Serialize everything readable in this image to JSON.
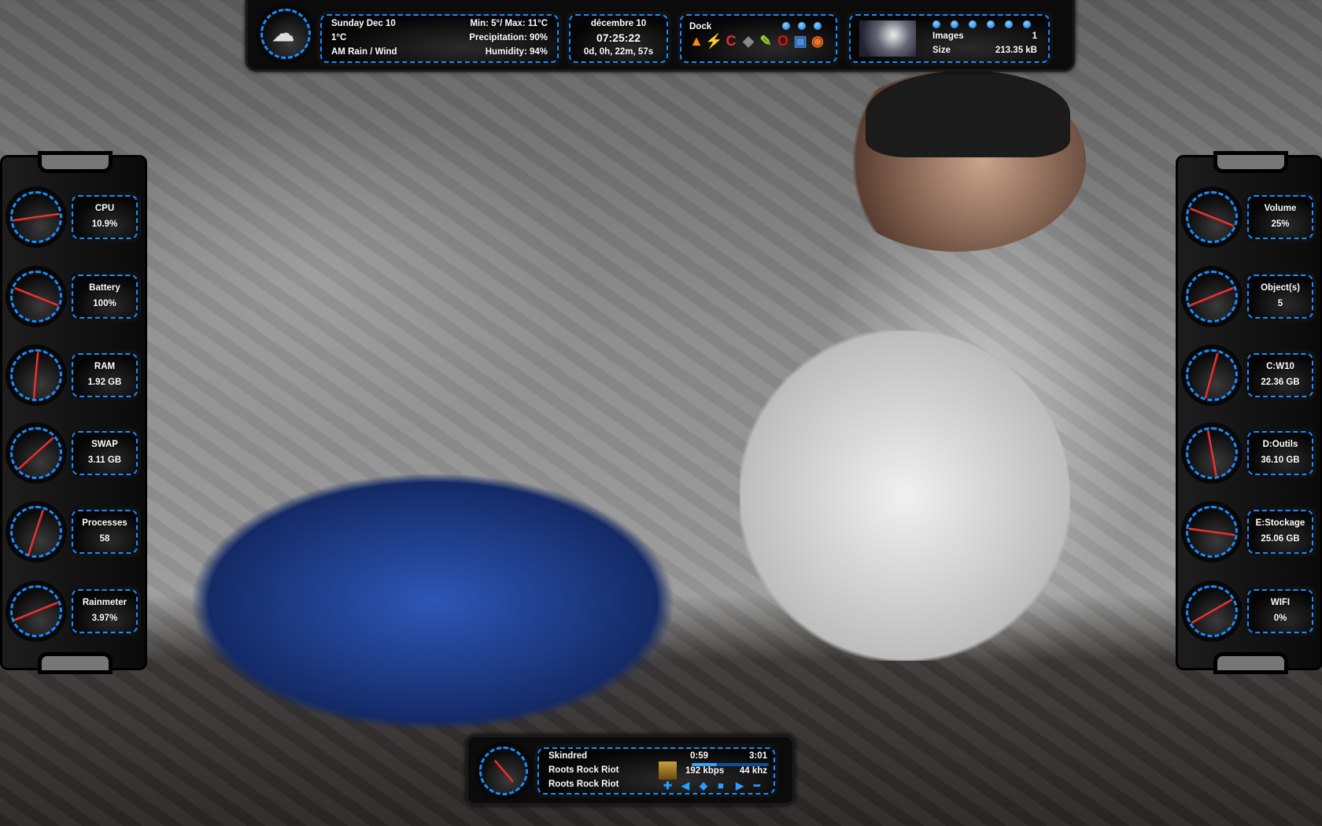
{
  "weather": {
    "icon": "cloud-rain-icon",
    "date": "Sunday Dec 10",
    "minmax": "Min: 5°/ Max: 11°C",
    "temp": "1°C",
    "precipitation": "Precipitation: 90%",
    "condition": "AM Rain / Wind",
    "humidity": "Humidity: 94%"
  },
  "clock": {
    "date": "décembre 10",
    "time": "07:25:22",
    "uptime": "0d, 0h, 22m, 57s"
  },
  "dock": {
    "title": "Dock",
    "pages": 3,
    "icons": [
      "vlc-icon",
      "winamp-icon",
      "ccleaner-icon",
      "gimp-icon",
      "notepad-icon",
      "opera-icon",
      "paint-icon",
      "eye-viewer-icon"
    ]
  },
  "images": {
    "label": "Images",
    "count": "1",
    "size_label": "Size",
    "size": "213.35 kB",
    "pages": 6
  },
  "left_gauges": [
    {
      "label": "CPU",
      "value": "10.9%",
      "needle_deg": -8
    },
    {
      "label": "Battery",
      "value": "100%",
      "needle_deg": 22
    },
    {
      "label": "RAM",
      "value": "1.92 GB",
      "needle_deg": -85
    },
    {
      "label": "SWAP",
      "value": "3.11 GB",
      "needle_deg": -42
    },
    {
      "label": "Processes",
      "value": "58",
      "needle_deg": -72
    },
    {
      "label": "Rainmeter",
      "value": "3.97%",
      "needle_deg": -22
    }
  ],
  "right_gauges": [
    {
      "label": "Volume",
      "value": "25%",
      "needle_deg": 22
    },
    {
      "label": "Object(s)",
      "value": "5",
      "needle_deg": -22
    },
    {
      "label": "C:W10",
      "value": "22.36 GB",
      "needle_deg": -75
    },
    {
      "label": "D:Outils",
      "value": "36.10 GB",
      "needle_deg": 80
    },
    {
      "label": "E:Stockage",
      "value": "25.06 GB",
      "needle_deg": 8
    },
    {
      "label": "WIFI",
      "value": "0%",
      "needle_deg": -30
    }
  ],
  "player": {
    "artist": "Skindred",
    "album": "Roots Rock Riot",
    "track": "Roots Rock Riot",
    "elapsed": "0:59",
    "duration": "3:01",
    "progress": 0.33,
    "bitrate": "192 kbps",
    "samplerate": "44 khz",
    "needle_deg": 50,
    "controls": [
      "shuffle-icon",
      "previous-icon",
      "play-pause-icon",
      "stop-icon",
      "next-icon",
      "volume-minus-icon"
    ]
  },
  "colors": {
    "accent": "#1a8cff",
    "needle": "#e02020",
    "panel": "#0b0b0b"
  }
}
